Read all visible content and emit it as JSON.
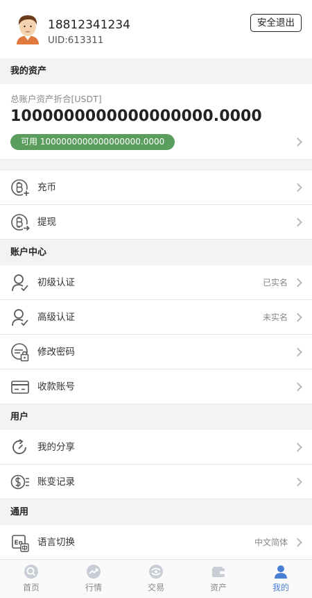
{
  "profile": {
    "phone": "18812341234",
    "uid": "UID:613311",
    "logout_label": "安全退出"
  },
  "assets": {
    "section_title": "我的资产",
    "total_label": "总账户资产折合[USDT]",
    "total_value": "1000000000000000000.0000",
    "available_label": "可用 1000000000000000000.0000"
  },
  "wallet_items": [
    {
      "label": "充币",
      "icon": "deposit-icon"
    },
    {
      "label": "提现",
      "icon": "withdraw-icon"
    }
  ],
  "account_center": {
    "title": "账户中心",
    "items": [
      {
        "label": "初级认证",
        "value": "已实名",
        "icon": "user-check-icon"
      },
      {
        "label": "高级认证",
        "value": "未实名",
        "icon": "user-check-icon"
      },
      {
        "label": "修改密码",
        "value": "",
        "icon": "password-icon"
      },
      {
        "label": "收款账号",
        "value": "",
        "icon": "card-icon"
      }
    ]
  },
  "user": {
    "title": "用户",
    "items": [
      {
        "label": "我的分享",
        "icon": "share-icon"
      },
      {
        "label": "账变记录",
        "icon": "record-icon"
      }
    ]
  },
  "general": {
    "title": "通用",
    "items": [
      {
        "label": "语言切换",
        "value": "中文简体",
        "icon": "language-icon"
      }
    ]
  },
  "tabbar": [
    {
      "label": "首页",
      "icon": "home-icon",
      "active": false
    },
    {
      "label": "行情",
      "icon": "market-icon",
      "active": false
    },
    {
      "label": "交易",
      "icon": "trade-icon",
      "active": false
    },
    {
      "label": "资产",
      "icon": "wallet-icon",
      "active": false
    },
    {
      "label": "我的",
      "icon": "profile-icon",
      "active": true
    }
  ],
  "colors": {
    "accent": "#4a7fd6",
    "available_pill": "#5a9d5c",
    "section_bg": "#f3f3f3"
  }
}
